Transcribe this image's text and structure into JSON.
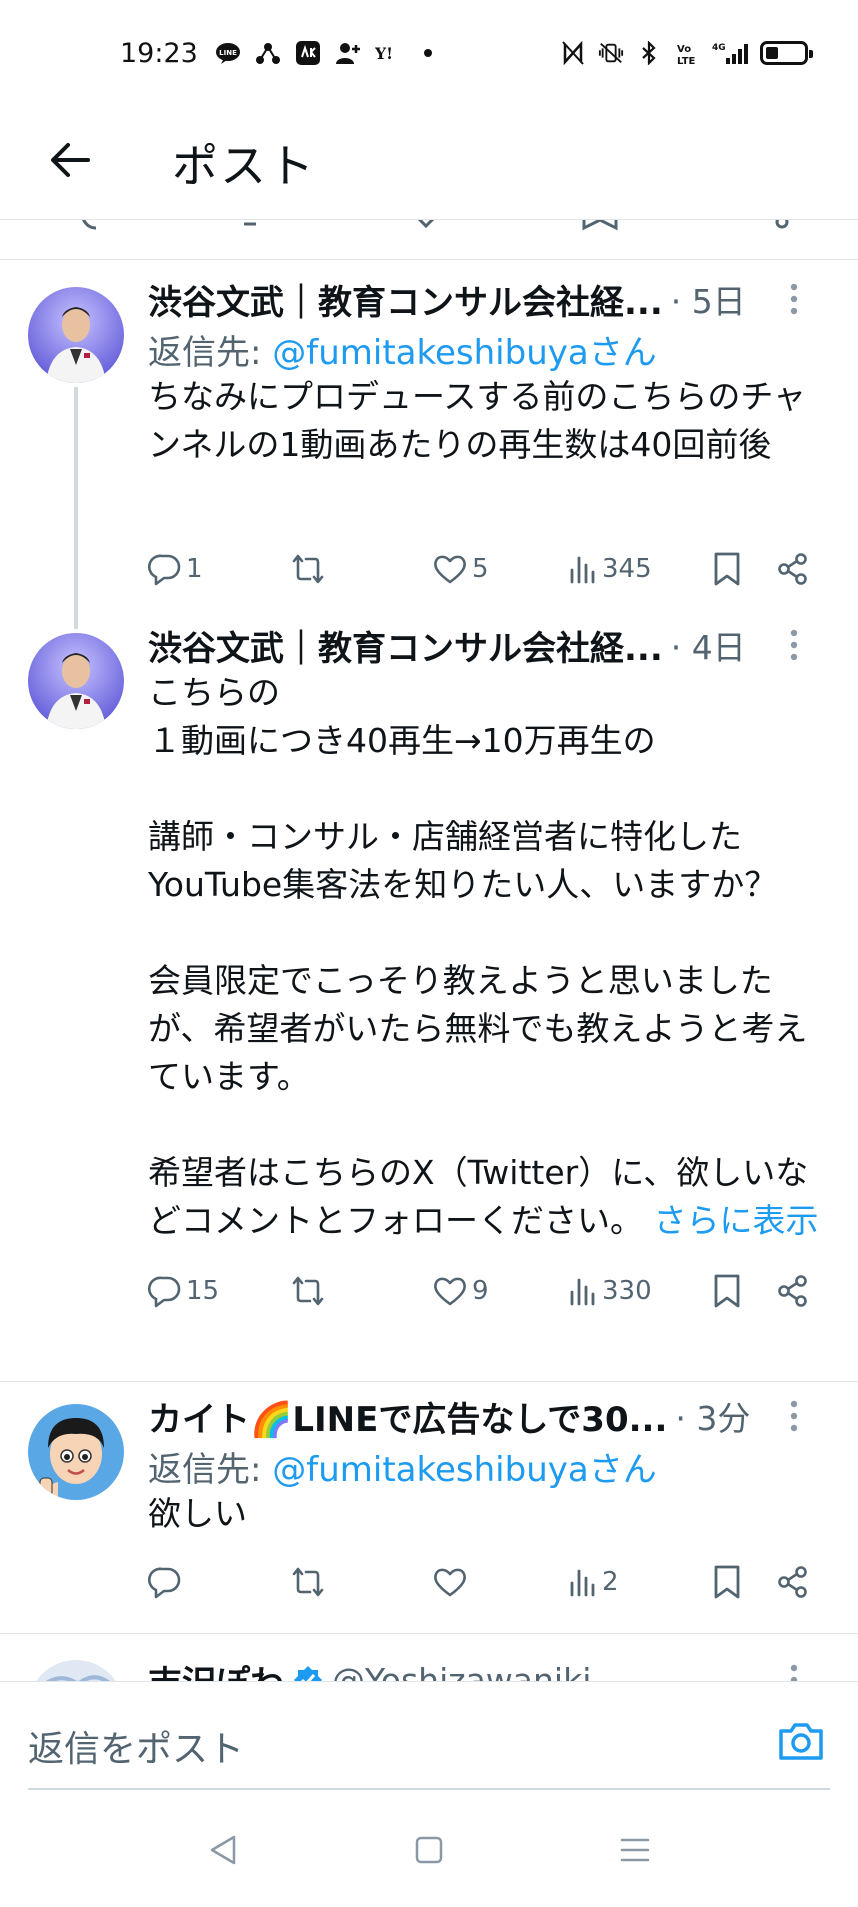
{
  "status_bar": {
    "time": "19:23",
    "left_icons": [
      "line-icon",
      "link-icon",
      "app-icon",
      "person-add-icon",
      "yahoo-icon",
      "dot-icon"
    ],
    "right_icons": [
      "nfc-icon",
      "vibrate-icon",
      "bluetooth-icon",
      "volte-icon",
      "signal-4g-icon",
      "battery-icon"
    ],
    "network": "4G"
  },
  "header": {
    "title": "ポスト"
  },
  "tweets": [
    {
      "name": "渋谷文武｜教育コンサル会社経...",
      "time": "· 5日",
      "reply_prefix": "返信先: ",
      "reply_handle": "@fumitakeshibuyaさん",
      "text": "ちなみにプロデュースする前のこちらのチャンネルの1動画あたりの再生数は40回前後",
      "replies": "1",
      "retweets": "",
      "likes": "5",
      "views": "345"
    },
    {
      "name": "渋谷文武｜教育コンサル会社経...",
      "time": "· 4日",
      "text": "こちらの\n１動画につき40再生→10万再生の\n\n講師・コンサル・店舗経営者に特化したYouTube集客法を知りたい人、いますか？\n\n会員限定でこっそり教えようと思いましたが、希望者がいたら無料でも教えようと考えています。\n\n希望者はこちらのX（Twitter）に、欲しいなどコメントとフォローください。",
      "show_more": "さらに表示",
      "replies": "15",
      "retweets": "",
      "likes": "9",
      "views": "330"
    },
    {
      "name": "カイト🌈LINEで広告なしで30...",
      "time": "· 3分",
      "reply_prefix": "返信先: ",
      "reply_handle": "@fumitakeshibuyaさん",
      "text": "欲しい",
      "replies": "",
      "retweets": "",
      "likes": "",
      "views": "2"
    },
    {
      "name": "吉沢ぽわ",
      "handle": "@Yoshizawaniki",
      "verified": true
    }
  ],
  "composer": {
    "placeholder": "返信をポスト"
  },
  "colors": {
    "accent": "#1d9bf0",
    "secondary_text": "#536471",
    "divider": "#e1e6ea"
  }
}
